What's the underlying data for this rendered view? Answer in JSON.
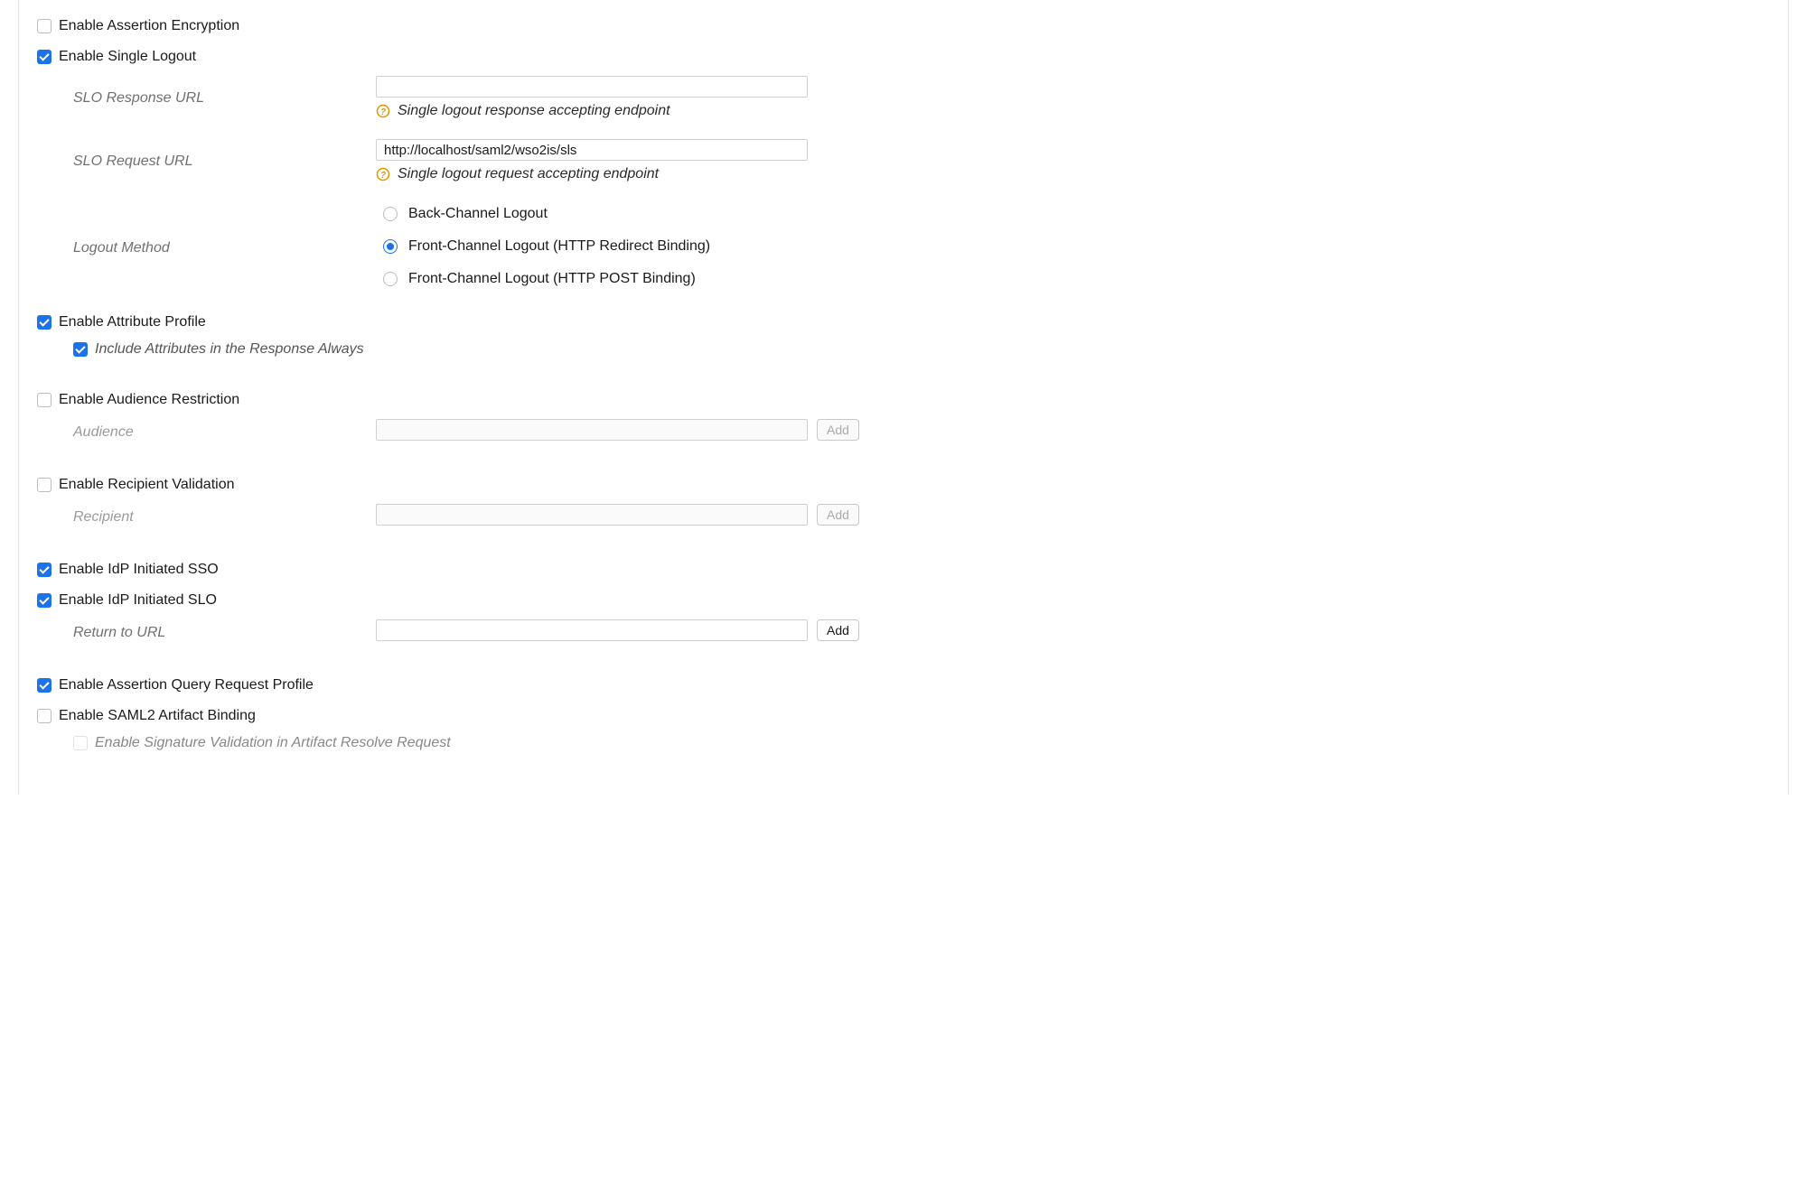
{
  "labels": {
    "enable_assertion_encryption": "Enable Assertion Encryption",
    "enable_single_logout": "Enable Single Logout",
    "slo_response_url": "SLO Response URL",
    "slo_request_url": "SLO Request URL",
    "logout_method": "Logout Method",
    "enable_attribute_profile": "Enable Attribute Profile",
    "include_attributes_always": "Include Attributes in the Response Always",
    "enable_audience_restriction": "Enable Audience Restriction",
    "audience": "Audience",
    "enable_recipient_validation": "Enable Recipient Validation",
    "recipient": "Recipient",
    "enable_idp_sso": "Enable IdP Initiated SSO",
    "enable_idp_slo": "Enable IdP Initiated SLO",
    "return_to_url": "Return to URL",
    "enable_assertion_query": "Enable Assertion Query Request Profile",
    "enable_saml2_artifact": "Enable SAML2 Artifact Binding",
    "enable_sig_validation_artifact": "Enable Signature Validation in Artifact Resolve Request",
    "add": "Add"
  },
  "helpers": {
    "slo_response": "Single logout response accepting endpoint",
    "slo_request": "Single logout request accepting endpoint"
  },
  "logout_method_options": {
    "back_channel": "Back-Channel Logout",
    "front_redirect": "Front-Channel Logout (HTTP Redirect Binding)",
    "front_post": "Front-Channel Logout (HTTP POST Binding)"
  },
  "values": {
    "slo_response_url": "",
    "slo_request_url": "http://localhost/saml2/wso2is/sls",
    "logout_method_selected": "front_redirect",
    "audience": "",
    "recipient": "",
    "return_to_url": ""
  },
  "checks": {
    "enable_assertion_encryption": false,
    "enable_single_logout": true,
    "enable_attribute_profile": true,
    "include_attributes_always": true,
    "enable_audience_restriction": false,
    "enable_recipient_validation": false,
    "enable_idp_sso": true,
    "enable_idp_slo": true,
    "enable_assertion_query": true,
    "enable_saml2_artifact": false,
    "enable_sig_validation_artifact": false
  }
}
